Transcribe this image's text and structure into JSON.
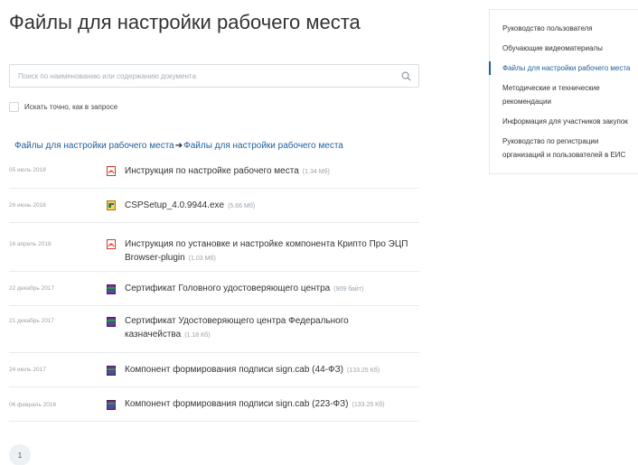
{
  "page": {
    "title": "Файлы для настройки рабочего места"
  },
  "search": {
    "placeholder": "Поиск по наименованию или содержанию документа",
    "exact_label": "Искать точно, как в запросе"
  },
  "breadcrumb": {
    "first": "Файлы для настройки рабочего места",
    "separator": "➔",
    "second": "Файлы для настройки рабочего места"
  },
  "files": [
    {
      "date": "05 июль 2018",
      "icon": "pdf-icon",
      "name": "Инструкция по настройке рабочего места",
      "size": "(1.34 Мб)"
    },
    {
      "date": "26 июнь 2018",
      "icon": "exe-icon",
      "name": "CSPSetup_4.0.9944.exe",
      "size": "(5.66 Мб)"
    },
    {
      "date": "16 апрель 2018",
      "icon": "pdf-icon",
      "name": "Инструкция по установке и настройке компонента Крипто Про ЭЦП Browser-plugin",
      "size": "(1.03 Мб)"
    },
    {
      "date": "22 декабрь 2017",
      "icon": "archive-icon",
      "name": "Сертификат Головного удостоверяющего центра",
      "size": "(909 байт)"
    },
    {
      "date": "21 декабрь 2017",
      "icon": "archive-icon",
      "name": "Сертификат Удостоверяющего центра Федерального казначейства",
      "size": "(1.18 Кб)"
    },
    {
      "date": "24 июль 2017",
      "icon": "archive-icon",
      "name": "Компонент формирования подписи sign.cab (44-ФЗ)",
      "size": "(133.25 Кб)"
    },
    {
      "date": "06 февраль 2016",
      "icon": "archive-icon",
      "name": "Компонент формирования подписи sign.cab (223-ФЗ)",
      "size": "(133.25 Кб)"
    }
  ],
  "pagination": {
    "current": "1"
  },
  "sidebar": {
    "items": [
      {
        "label": "Руководство пользователя",
        "active": false
      },
      {
        "label": "Обучающие видеоматериалы",
        "active": false
      },
      {
        "label": "Файлы для настройки рабочего места",
        "active": true
      },
      {
        "label": "Методические и технические рекомендации",
        "active": false
      },
      {
        "label": "Информация для участников закупок",
        "active": false
      },
      {
        "label": "Руководство по регистрации организаций и пользователей в ЕИС",
        "active": false
      }
    ]
  },
  "colors": {
    "link": "#1f5f9e",
    "pdf": "#d9342b",
    "muted": "#9aa3ab"
  }
}
